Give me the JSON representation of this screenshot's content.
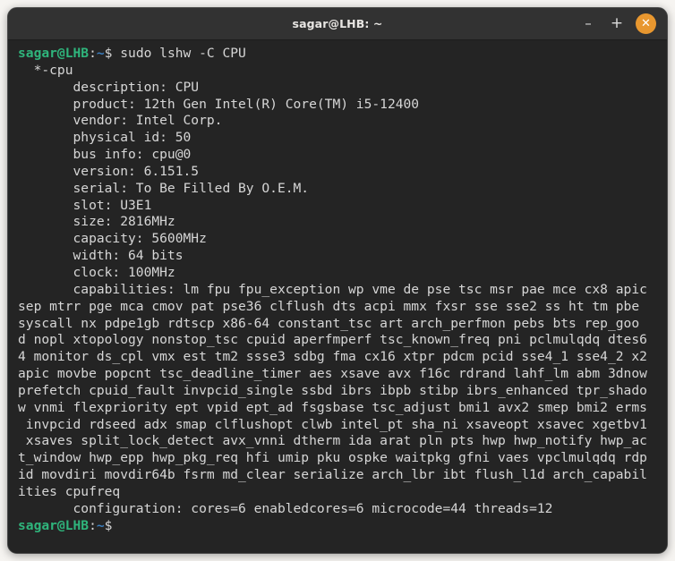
{
  "window": {
    "title": "sagar@LHB: ~",
    "buttons": {
      "minimize": "–",
      "maximize": "+",
      "close": "✕"
    }
  },
  "prompt": {
    "user_host": "sagar@LHB",
    "colon": ":",
    "path": "~",
    "symbol": "$"
  },
  "session": {
    "command": " sudo lshw -C CPU",
    "output_lines": [
      "  *-cpu",
      "       description: CPU",
      "       product: 12th Gen Intel(R) Core(TM) i5-12400",
      "       vendor: Intel Corp.",
      "       physical id: 50",
      "       bus info: cpu@0",
      "       version: 6.151.5",
      "       serial: To Be Filled By O.E.M.",
      "       slot: U3E1",
      "       size: 2816MHz",
      "       capacity: 5600MHz",
      "       width: 64 bits",
      "       clock: 100MHz",
      "       capabilities: lm fpu fpu_exception wp vme de pse tsc msr pae mce cx8 apic",
      "sep mtrr pge mca cmov pat pse36 clflush dts acpi mmx fxsr sse sse2 ss ht tm pbe",
      "syscall nx pdpe1gb rdtscp x86-64 constant_tsc art arch_perfmon pebs bts rep_goo",
      "d nopl xtopology nonstop_tsc cpuid aperfmperf tsc_known_freq pni pclmulqdq dtes6",
      "4 monitor ds_cpl vmx est tm2 ssse3 sdbg fma cx16 xtpr pdcm pcid sse4_1 sse4_2 x2",
      "apic movbe popcnt tsc_deadline_timer aes xsave avx f16c rdrand lahf_lm abm 3dnow",
      "prefetch cpuid_fault invpcid_single ssbd ibrs ibpb stibp ibrs_enhanced tpr_shado",
      "w vnmi flexpriority ept vpid ept_ad fsgsbase tsc_adjust bmi1 avx2 smep bmi2 erms",
      " invpcid rdseed adx smap clflushopt clwb intel_pt sha_ni xsaveopt xsavec xgetbv1",
      " xsaves split_lock_detect avx_vnni dtherm ida arat pln pts hwp hwp_notify hwp_ac",
      "t_window hwp_epp hwp_pkg_req hfi umip pku ospke waitpkg gfni vaes vpclmulqdq rdp",
      "id movdiri movdir64b fsrm md_clear serialize arch_lbr ibt flush_l1d arch_capabil",
      "ities cpufreq",
      "       configuration: cores=6 enabledcores=6 microcode=44 threads=12"
    ]
  },
  "colors": {
    "background": "#242424",
    "titlebar": "#323232",
    "foreground": "#d6d6d6",
    "prompt_user": "#2fb57c",
    "prompt_path": "#3a7ebf",
    "close_button": "#e8972f",
    "desktop": "#f6f4f1"
  }
}
